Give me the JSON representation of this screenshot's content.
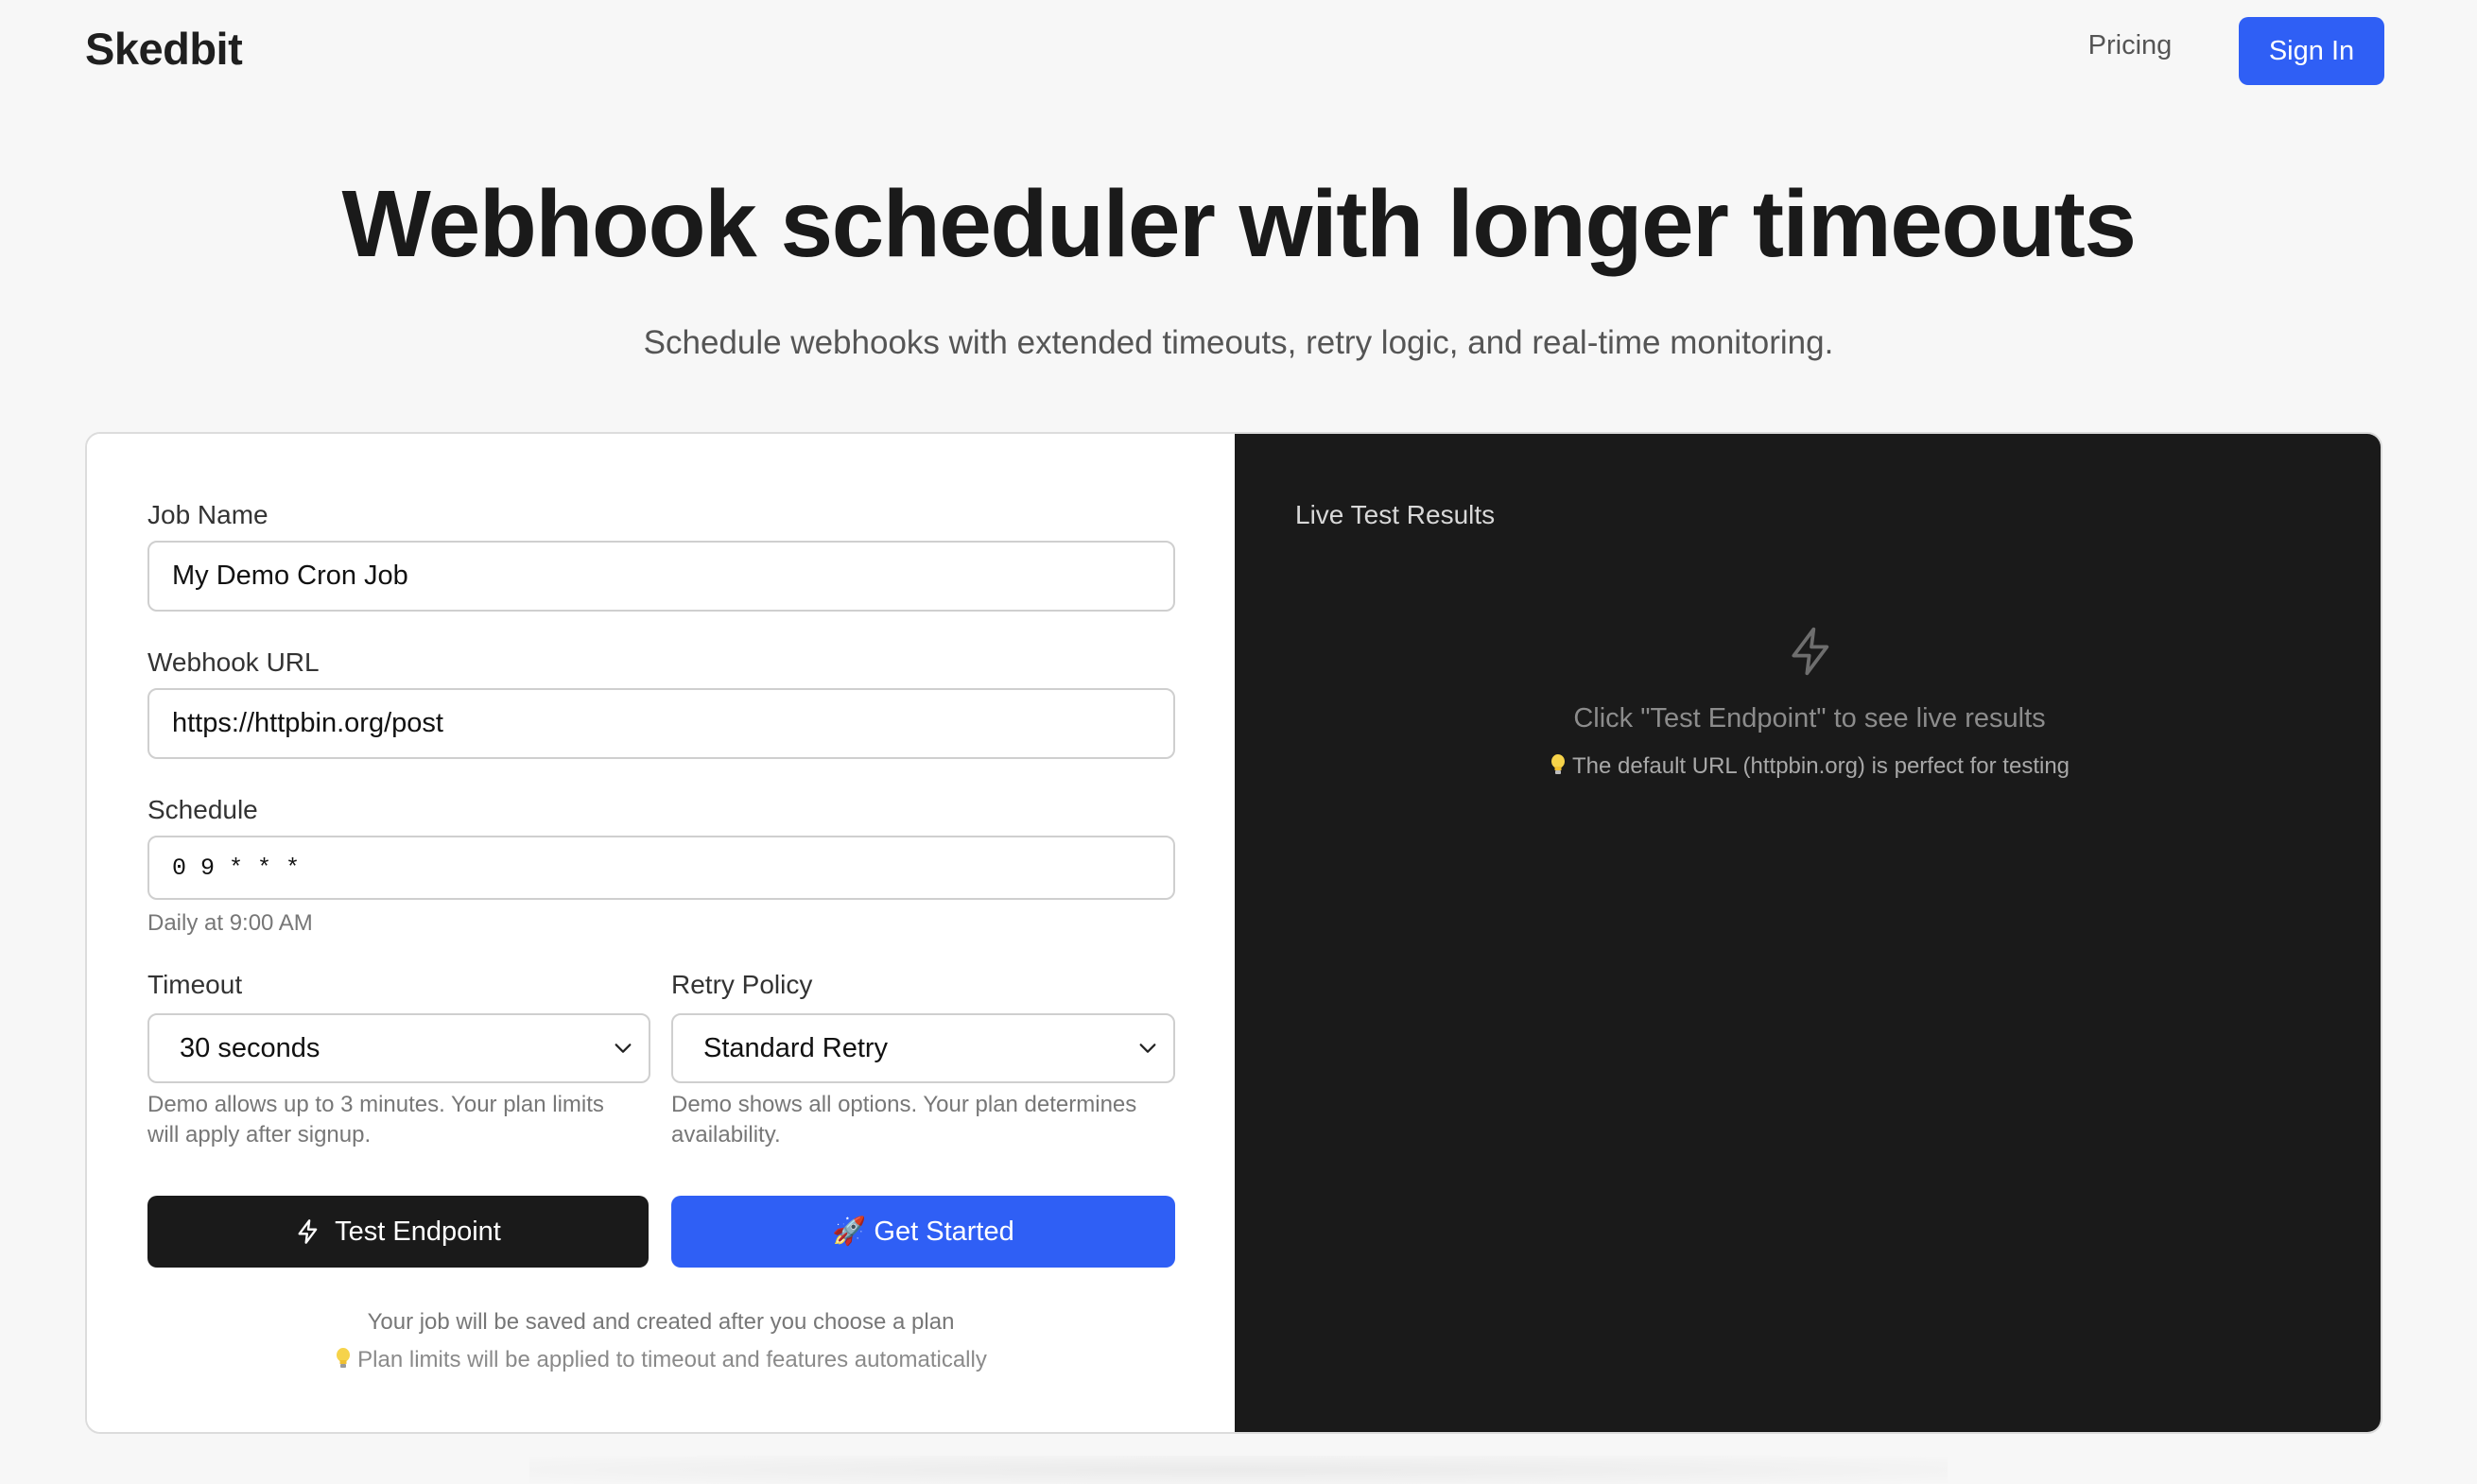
{
  "nav": {
    "logo": "Skedbit",
    "pricing_link": "Pricing",
    "signin_button": "Sign In"
  },
  "hero": {
    "title": "Webhook scheduler with longer timeouts",
    "subtitle": "Schedule webhooks with extended timeouts, retry logic, and real-time monitoring."
  },
  "form": {
    "job_name": {
      "label": "Job Name",
      "value": "My Demo Cron Job"
    },
    "webhook_url": {
      "label": "Webhook URL",
      "value": "https://httpbin.org/post"
    },
    "schedule": {
      "label": "Schedule",
      "value": "0 9 * * *",
      "hint": "Daily at 9:00 AM"
    },
    "timeout": {
      "label": "Timeout",
      "selected": "30 seconds",
      "hint_line1": "Demo allows up to 3 minutes. Your plan limits",
      "hint_line2": "will apply after signup."
    },
    "retry_policy": {
      "label": "Retry Policy",
      "selected": "Standard Retry",
      "hint_line1": "Demo shows all options. Your plan determines",
      "hint_line2": "availability."
    },
    "test_button": "Test Endpoint",
    "start_button": "🚀 Get Started",
    "footnote_line1": "Your job will be saved and created after you choose a plan",
    "footnote_line2": "Plan limits will be applied to timeout and features automatically"
  },
  "results": {
    "title": "Live Test Results",
    "empty_message": "Click \"Test Endpoint\" to see live results",
    "tip": "The default URL (httpbin.org) is perfect for testing"
  },
  "icons": {
    "bolt": "lightning-bolt-icon",
    "bulb": "lightbulb-icon",
    "chevron": "chevron-down-icon"
  },
  "colors": {
    "accent": "#2f5ff5",
    "dark": "#1a1a1a",
    "background": "#f7f7f7"
  }
}
